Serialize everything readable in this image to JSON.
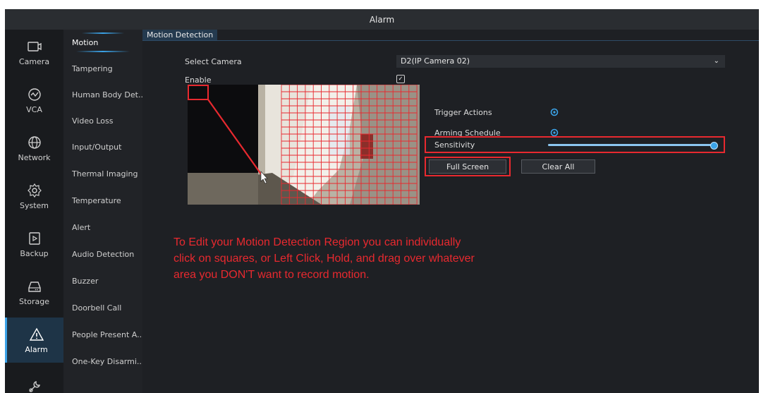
{
  "window": {
    "title": "Alarm"
  },
  "left_nav": [
    {
      "label": "Camera",
      "icon": "camera-icon",
      "active": false
    },
    {
      "label": "VCA",
      "icon": "vca-icon",
      "active": false
    },
    {
      "label": "Network",
      "icon": "globe-icon",
      "active": false
    },
    {
      "label": "System",
      "icon": "gear-icon",
      "active": false
    },
    {
      "label": "Backup",
      "icon": "backup-icon",
      "active": false
    },
    {
      "label": "Storage",
      "icon": "storage-icon",
      "active": false
    },
    {
      "label": "Alarm",
      "icon": "alarm-icon",
      "active": true
    },
    {
      "label": "",
      "icon": "wrench-icon",
      "active": false
    }
  ],
  "sub_nav": [
    {
      "label": "Motion",
      "active": true
    },
    {
      "label": "Tampering"
    },
    {
      "label": "Human Body Det..."
    },
    {
      "label": "Video Loss"
    },
    {
      "label": "Input/Output"
    },
    {
      "label": "Thermal Imaging"
    },
    {
      "label": "Temperature"
    },
    {
      "label": "Alert"
    },
    {
      "label": "Audio Detection"
    },
    {
      "label": "Buzzer"
    },
    {
      "label": "Doorbell Call"
    },
    {
      "label": "People Present A..."
    },
    {
      "label": "One-Key Disarmi..."
    }
  ],
  "tab": {
    "label": "Motion Detection"
  },
  "form": {
    "select_camera_label": "Select Camera",
    "select_camera_value": "D2(IP Camera 02)",
    "enable_label": "Enable",
    "enable_checked": true,
    "trigger_actions_label": "Trigger Actions",
    "arming_schedule_label": "Arming Schedule",
    "sensitivity_label": "Sensitivity",
    "sensitivity_value": 1.0,
    "full_screen_label": "Full Screen",
    "clear_all_label": "Clear All"
  },
  "annotation": {
    "text": "To Edit your Motion Detection Region you can individually click on squares, or Left Click, Hold, and drag over whatever area you DON'T want to record motion.",
    "color": "#e8292f"
  },
  "colors": {
    "accent": "#3ba3e8",
    "highlight": "#e8292f",
    "background": "#1e2024"
  }
}
